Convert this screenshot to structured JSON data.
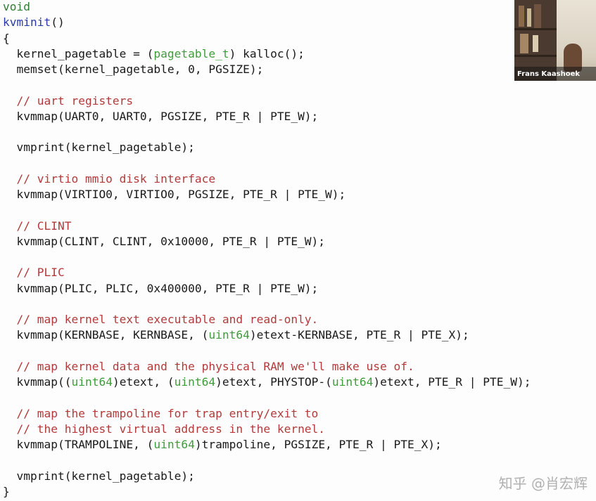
{
  "colors": {
    "keyword": "#2e7d32",
    "function": "#2a3aa8",
    "type": "#3f9c3a",
    "comment": "#b23a3a",
    "text": "#1a1a1a",
    "background": "#fdfdfd"
  },
  "code": {
    "lines": [
      [
        {
          "k": "keyword",
          "t": "void"
        }
      ],
      [
        {
          "k": "func",
          "t": "kvminit"
        },
        {
          "k": "plain",
          "t": "()"
        }
      ],
      [
        {
          "k": "plain",
          "t": "{"
        }
      ],
      [
        {
          "k": "plain",
          "t": "  kernel_pagetable = ("
        },
        {
          "k": "type",
          "t": "pagetable_t"
        },
        {
          "k": "plain",
          "t": ") kalloc();"
        }
      ],
      [
        {
          "k": "plain",
          "t": "  memset(kernel_pagetable, 0, PGSIZE);"
        }
      ],
      [],
      [
        {
          "k": "comment",
          "t": "  // uart registers"
        }
      ],
      [
        {
          "k": "plain",
          "t": "  kvmmap(UART0, UART0, PGSIZE, PTE_R | PTE_W);"
        }
      ],
      [],
      [
        {
          "k": "plain",
          "t": "  vmprint(kernel_pagetable);"
        }
      ],
      [],
      [
        {
          "k": "comment",
          "t": "  // virtio mmio disk interface"
        }
      ],
      [
        {
          "k": "plain",
          "t": "  kvmmap(VIRTIO0, VIRTIO0, PGSIZE, PTE_R | PTE_W);"
        }
      ],
      [],
      [
        {
          "k": "comment",
          "t": "  // CLINT"
        }
      ],
      [
        {
          "k": "plain",
          "t": "  kvmmap(CLINT, CLINT, 0x10000, PTE_R | PTE_W);"
        }
      ],
      [],
      [
        {
          "k": "comment",
          "t": "  // PLIC"
        }
      ],
      [
        {
          "k": "plain",
          "t": "  kvmmap(PLIC, PLIC, 0x400000, PTE_R | PTE_W);"
        }
      ],
      [],
      [
        {
          "k": "comment",
          "t": "  // map kernel text executable and read-only."
        }
      ],
      [
        {
          "k": "plain",
          "t": "  kvmmap(KERNBASE, KERNBASE, ("
        },
        {
          "k": "type",
          "t": "uint64"
        },
        {
          "k": "plain",
          "t": ")etext-KERNBASE, PTE_R | PTE_X);"
        }
      ],
      [],
      [
        {
          "k": "comment",
          "t": "  // map kernel data and the physical RAM we'll make use of."
        }
      ],
      [
        {
          "k": "plain",
          "t": "  kvmmap(("
        },
        {
          "k": "type",
          "t": "uint64"
        },
        {
          "k": "plain",
          "t": ")etext, ("
        },
        {
          "k": "type",
          "t": "uint64"
        },
        {
          "k": "plain",
          "t": ")etext, PHYSTOP-("
        },
        {
          "k": "type",
          "t": "uint64"
        },
        {
          "k": "plain",
          "t": ")etext, PTE_R | PTE_W);"
        }
      ],
      [],
      [
        {
          "k": "comment",
          "t": "  // map the trampoline for trap entry/exit to"
        }
      ],
      [
        {
          "k": "comment",
          "t": "  // the highest virtual address in the kernel."
        }
      ],
      [
        {
          "k": "plain",
          "t": "  kvmmap(TRAMPOLINE, ("
        },
        {
          "k": "type",
          "t": "uint64"
        },
        {
          "k": "plain",
          "t": ")trampoline, PGSIZE, PTE_R | PTE_X);"
        }
      ],
      [],
      [
        {
          "k": "plain",
          "t": "  vmprint(kernel_pagetable);"
        }
      ],
      [
        {
          "k": "plain",
          "t": "}"
        }
      ]
    ]
  },
  "video": {
    "speaker_name": "Frans Kaashoek"
  },
  "watermark": {
    "text": "知乎 @肖宏辉"
  }
}
